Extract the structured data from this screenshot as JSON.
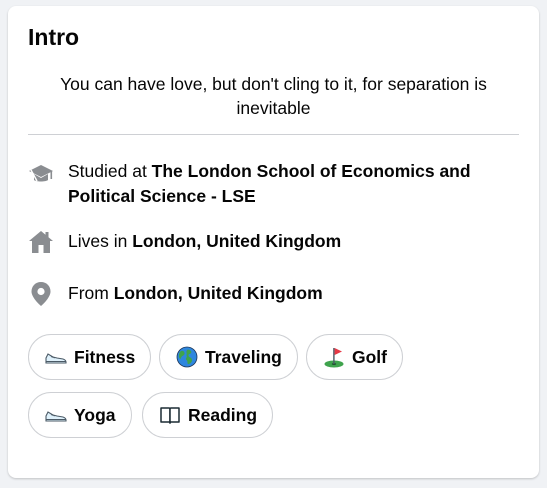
{
  "intro": {
    "title": "Intro",
    "bio": "You can have love, but don't cling to it, for separation is inevitable"
  },
  "details": {
    "education": {
      "icon": "graduation-cap-icon",
      "prefix": "Studied at ",
      "value": "The London School of Economics and Political Science - LSE"
    },
    "residence": {
      "icon": "house-icon",
      "prefix": "Lives in ",
      "value": "London, United Kingdom"
    },
    "hometown": {
      "icon": "location-pin-icon",
      "prefix": "From ",
      "value": "London, United Kingdom"
    }
  },
  "hobbies": [
    {
      "label": "Fitness",
      "icon": "sneaker-icon"
    },
    {
      "label": "Traveling",
      "icon": "globe-icon"
    },
    {
      "label": "Golf",
      "icon": "golf-flag-icon"
    },
    {
      "label": "Yoga",
      "icon": "sneaker-icon"
    },
    {
      "label": "Reading",
      "icon": "open-book-icon"
    }
  ],
  "colors": {
    "icon_gray": "#8a8d91",
    "divider": "#ced0d4",
    "text": "#050505"
  }
}
